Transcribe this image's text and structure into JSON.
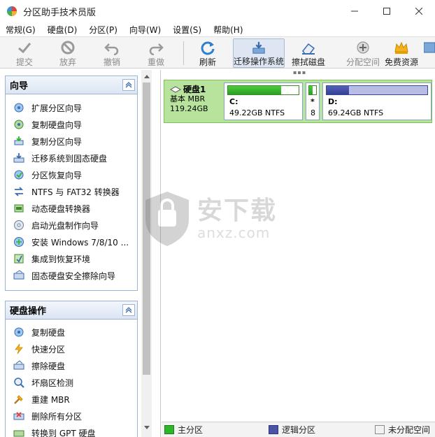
{
  "window": {
    "title": "分区助手技术员版"
  },
  "menu": [
    "常规(G)",
    "硬盘(D)",
    "分区(P)",
    "向导(W)",
    "设置(S)",
    "帮助(H)"
  ],
  "toolbar": {
    "commit": "提交",
    "discard": "放弃",
    "undo": "撤销",
    "redo": "重做",
    "refresh": "刷新",
    "migrate": "迁移操作系统",
    "wipe": "擦拭磁盘",
    "alloc": "分配空间",
    "free": "免费资源"
  },
  "wizard": {
    "title": "向导",
    "items": [
      "扩展分区向导",
      "复制硬盘向导",
      "复制分区向导",
      "迁移系统到固态硬盘",
      "分区恢复向导",
      "NTFS 与 FAT32 转换器",
      "动态硬盘转换器",
      "启动光盘制作向导",
      "安装 Windows 7/8/10 ...",
      "集成到恢复环境",
      "固态硬盘安全擦除向导"
    ]
  },
  "diskops": {
    "title": "硬盘操作",
    "items": [
      "复制硬盘",
      "快速分区",
      "擦除硬盘",
      "坏扇区检测",
      "重建 MBR",
      "删除所有分区",
      "转换到 GPT 硬盘"
    ]
  },
  "disk": {
    "name": "硬盘1",
    "type": "基本 MBR",
    "size": "119.24GB",
    "partitions": [
      {
        "label": "C:",
        "size": "49.22GB NTFS",
        "used": 0.75
      },
      {
        "label": "*",
        "size": "8",
        "used": 0.5
      },
      {
        "label": "D:",
        "size": "69.24GB NTFS",
        "used": 0.22
      }
    ]
  },
  "watermark": {
    "cn": "安下载",
    "en": "anxz.com"
  },
  "legend": {
    "primary": "主分区",
    "logical": "逻辑分区",
    "unalloc": "未分配空间"
  },
  "colors": {
    "primary": "#2fb52a",
    "logical": "#4a55a8",
    "disk_bg": "#b7e39c",
    "accent": "#3c6bb0"
  }
}
